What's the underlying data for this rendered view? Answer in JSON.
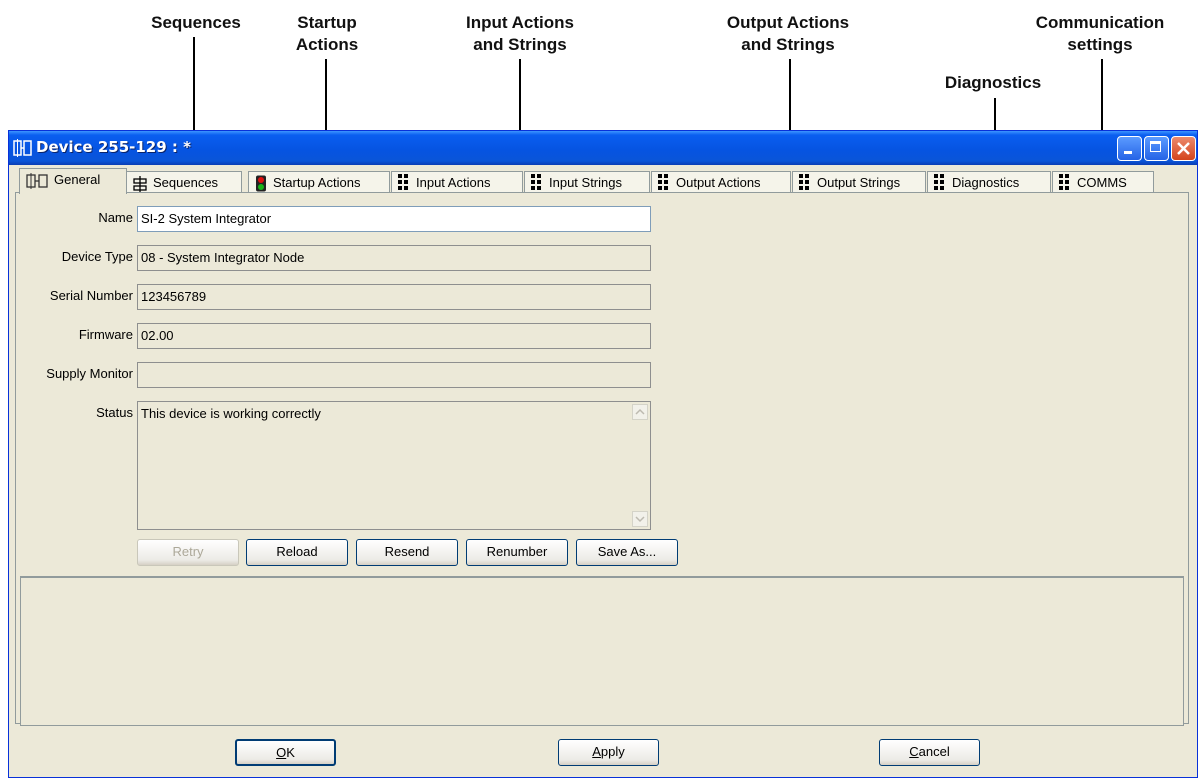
{
  "callouts": {
    "sequences": "Sequences",
    "startup_line1": "Startup",
    "startup_line2": "Actions",
    "input_line1": "Input Actions",
    "input_line2": "and Strings",
    "output_line1": "Output Actions",
    "output_line2": "and Strings",
    "comm_line1": "Communication",
    "comm_line2": "settings",
    "diagnostics": "Diagnostics"
  },
  "window": {
    "title": "Device 255-129 :",
    "title_marker": "*"
  },
  "tabs": [
    {
      "label": "General",
      "icon": "device-icon"
    },
    {
      "label": "Sequences",
      "icon": "sequence-icon"
    },
    {
      "label": "Startup Actions",
      "icon": "traffic-light-icon"
    },
    {
      "label": "Input Actions",
      "icon": "dots-icon"
    },
    {
      "label": "Input Strings",
      "icon": "dots-icon"
    },
    {
      "label": "Output Actions",
      "icon": "dots-icon"
    },
    {
      "label": "Output Strings",
      "icon": "dots-icon"
    },
    {
      "label": "Diagnostics",
      "icon": "dots-icon"
    },
    {
      "label": "COMMS",
      "icon": "dots-icon"
    }
  ],
  "fields": {
    "name": {
      "label": "Name",
      "value": "SI-2 System Integrator"
    },
    "device_type": {
      "label": "Device Type",
      "value": "08 - System Integrator Node"
    },
    "serial_number": {
      "label": "Serial Number",
      "value": "123456789"
    },
    "firmware": {
      "label": "Firmware",
      "value": "02.00"
    },
    "supply_monitor": {
      "label": "Supply Monitor",
      "value": ""
    },
    "status": {
      "label": "Status",
      "value": "This device is working correctly"
    }
  },
  "actions": {
    "retry": "Retry",
    "reload": "Reload",
    "resend": "Resend",
    "renumber": "Renumber",
    "save_as": "Save As..."
  },
  "dialog_buttons": {
    "ok_key": "O",
    "ok_rest": "K",
    "apply_key": "A",
    "apply_rest": "pply",
    "cancel_key": "C",
    "cancel_rest": "ancel"
  },
  "colors": {
    "titlebar": "#0654e2",
    "face": "#ece9d8",
    "tab_border": "#919b9c"
  }
}
